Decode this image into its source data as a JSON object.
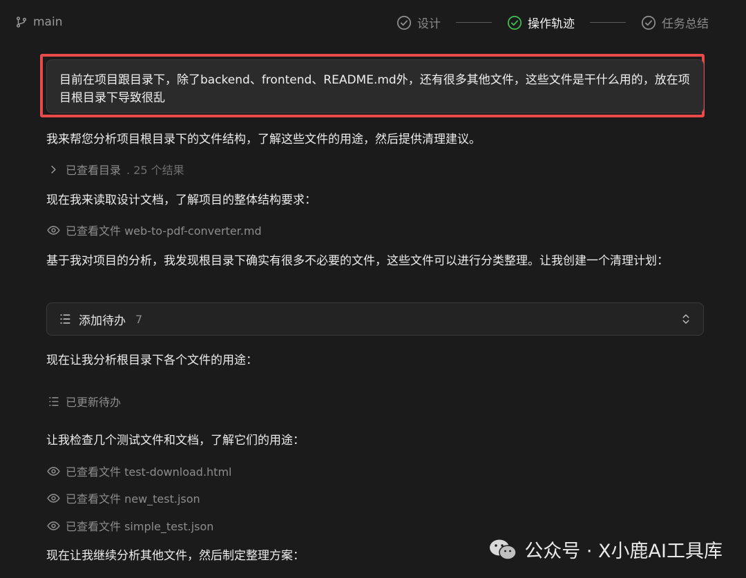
{
  "header": {
    "branch": "main",
    "steps": [
      {
        "label": "设计",
        "state": "done"
      },
      {
        "label": "操作轨迹",
        "state": "active"
      },
      {
        "label": "任务总结",
        "state": "done"
      }
    ]
  },
  "user_message": "目前在项目跟目录下，除了backend、frontend、README.md外，还有很多其他文件，这些文件是干什么用的，放在项目根目录下导致很乱",
  "timeline": {
    "msg1": "我来帮您分析项目根目录下的文件结构，了解这些文件的用途，然后提供清理建议。",
    "tool1_label": "已查看目录",
    "tool1_meta": ". 25 个结果",
    "msg2": "现在我来读取设计文档，了解项目的整体结构要求：",
    "tool2_label": "已查看文件 web-to-pdf-converter.md",
    "msg3": "基于我对项目的分析，我发现根目录下确实有很多不必要的文件，这些文件可以进行分类整理。让我创建一个清理计划：",
    "todo_label": "添加待办",
    "todo_count": "7",
    "msg4": "现在让我分析根目录下各个文件的用途：",
    "tool3_label": "已更新待办",
    "msg5": "让我检查几个测试文件和文档，了解它们的用途：",
    "tool4_label": "已查看文件 test-download.html",
    "tool5_label": "已查看文件 new_test.json",
    "tool6_label": "已查看文件 simple_test.json",
    "msg6": "现在让我继续分析其他文件，然后制定整理方案："
  },
  "watermark": "公众号 · X小鹿AI工具库",
  "colors": {
    "background": "#1b1b1b",
    "active_step": "#3fb950",
    "highlight": "#e94b4b"
  }
}
